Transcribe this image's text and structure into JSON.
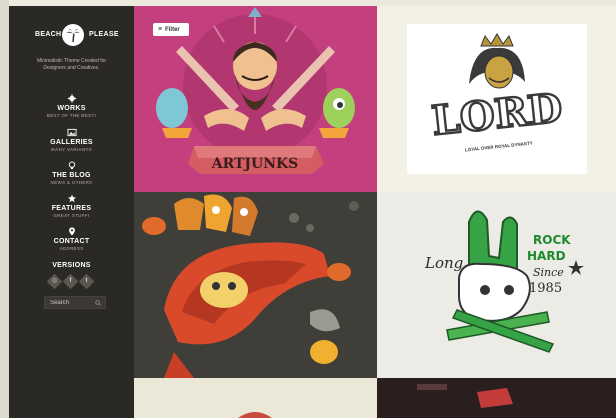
{
  "brand": {
    "left": "BEACH",
    "right": "PLEASE"
  },
  "tagline": [
    "Minimalistic Theme Created for",
    "Designers and Creatives."
  ],
  "nav": [
    {
      "icon": "gear-icon",
      "label": "WORKS",
      "sub": "BEST OF THE BEST!"
    },
    {
      "icon": "image-icon",
      "label": "GALLERIES",
      "sub": "MANY VARIANTS"
    },
    {
      "icon": "bulb-icon",
      "label": "THE BLOG",
      "sub": "NEWS & OTHERS"
    },
    {
      "icon": "star-icon",
      "label": "FEATURES",
      "sub": "GREAT STUFF!"
    },
    {
      "icon": "pin-icon",
      "label": "CONTACT",
      "sub": "ADDRESS"
    },
    {
      "icon": "",
      "label": "VERSIONS",
      "sub": ""
    }
  ],
  "socials": [
    "dribbble-icon",
    "facebook-icon",
    "twitter-icon"
  ],
  "search": {
    "placeholder": "Search"
  },
  "filter": {
    "label": "Filter"
  },
  "tiles": {
    "artjunks": {
      "text": "ARTJUNKS"
    },
    "lord": {
      "title": "LORD",
      "subtitle": "LOYAL OVER ROYAL DYNASTY"
    },
    "rockhard": {
      "line1": "Long",
      "line2": "ROCK",
      "line3": "HARD",
      "since": "Since",
      "year": "1985"
    }
  },
  "colors": {
    "sidebar": "#2b2926",
    "pink": "#c43f7d",
    "dark": "#3a3a3a",
    "cream": "#f3f0e5"
  }
}
